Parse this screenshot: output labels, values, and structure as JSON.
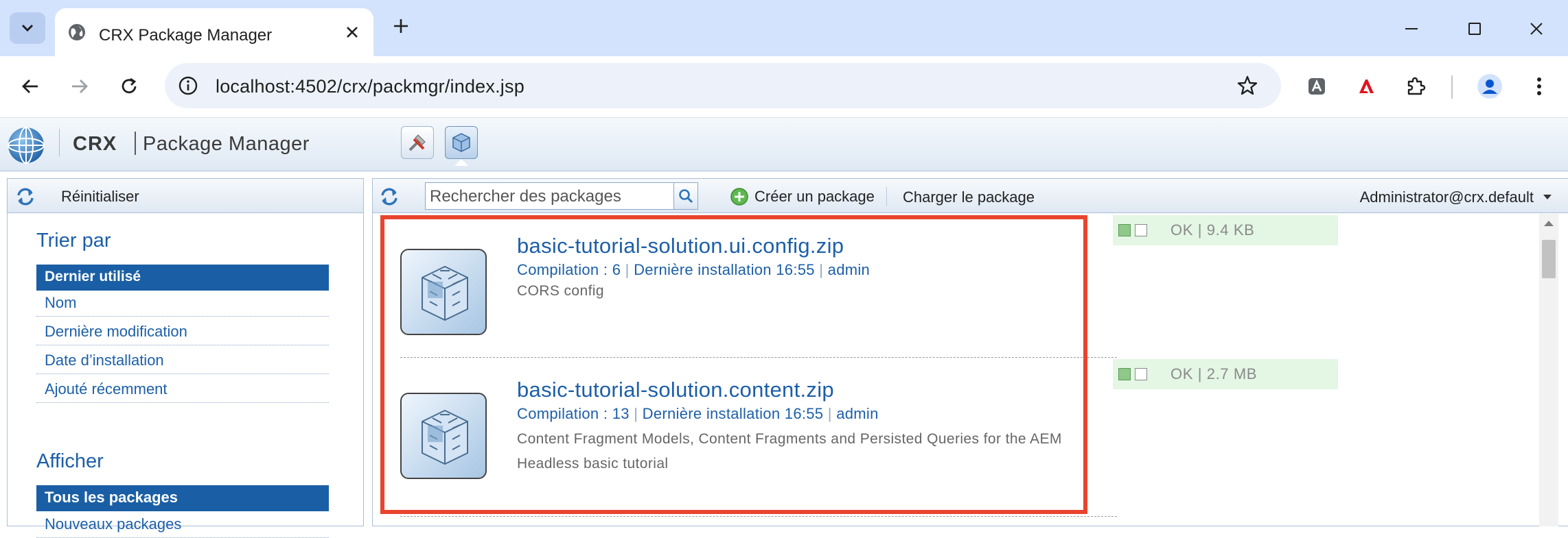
{
  "browser": {
    "tab_title": "CRX Package Manager",
    "url": "localhost:4502/crx/packmgr/index.jsp"
  },
  "app": {
    "brand": "CRX",
    "name": "Package Manager"
  },
  "left": {
    "reset_label": "Réinitialiser",
    "sort_title": "Trier par",
    "sort_options": [
      "Dernier utilisé",
      "Nom",
      "Dernière modification",
      "Date d’installation",
      "Ajouté récemment"
    ],
    "show_title": "Afficher",
    "show_options": [
      "Tous les packages",
      "Nouveaux packages"
    ]
  },
  "right": {
    "search_placeholder": "Rechercher des packages",
    "create_label": "Créer un package",
    "upload_label": "Charger le package",
    "user": "Administrator@crx.default"
  },
  "packages": [
    {
      "name": "basic-tutorial-solution.ui.config.zip",
      "build": "Compilation : 6",
      "installed": "Dernière installation 16:55",
      "user": "admin",
      "description": "CORS config",
      "status": "OK",
      "size": "9.4 KB"
    },
    {
      "name": "basic-tutorial-solution.content.zip",
      "build": "Compilation : 13",
      "installed": "Dernière installation 16:55",
      "user": "admin",
      "description": "Content Fragment Models, Content Fragments and Persisted Queries for the AEM Headless basic tutorial",
      "status": "OK",
      "size": "2.7 MB"
    }
  ],
  "colors": {
    "link_blue": "#1c5fa8",
    "selected_bg": "#1a5fa5",
    "highlight_red": "#e8442e",
    "status_bg": "#e4f6e4"
  }
}
